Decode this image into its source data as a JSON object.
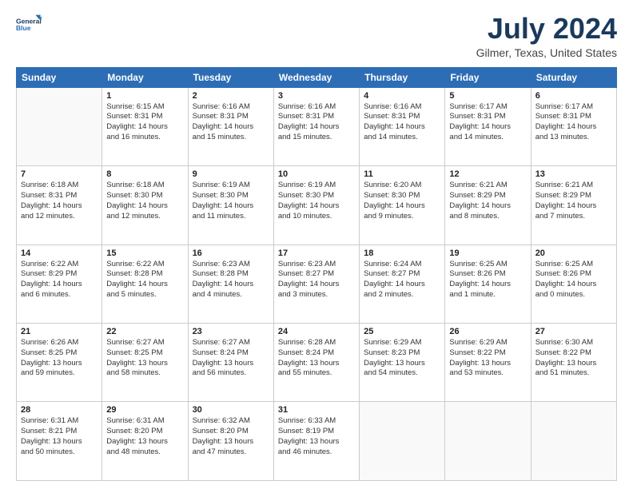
{
  "logo": {
    "line1": "General",
    "line2": "Blue"
  },
  "header": {
    "month": "July 2024",
    "location": "Gilmer, Texas, United States"
  },
  "weekdays": [
    "Sunday",
    "Monday",
    "Tuesday",
    "Wednesday",
    "Thursday",
    "Friday",
    "Saturday"
  ],
  "weeks": [
    [
      {
        "day": "",
        "info": ""
      },
      {
        "day": "1",
        "info": "Sunrise: 6:15 AM\nSunset: 8:31 PM\nDaylight: 14 hours\nand 16 minutes."
      },
      {
        "day": "2",
        "info": "Sunrise: 6:16 AM\nSunset: 8:31 PM\nDaylight: 14 hours\nand 15 minutes."
      },
      {
        "day": "3",
        "info": "Sunrise: 6:16 AM\nSunset: 8:31 PM\nDaylight: 14 hours\nand 15 minutes."
      },
      {
        "day": "4",
        "info": "Sunrise: 6:16 AM\nSunset: 8:31 PM\nDaylight: 14 hours\nand 14 minutes."
      },
      {
        "day": "5",
        "info": "Sunrise: 6:17 AM\nSunset: 8:31 PM\nDaylight: 14 hours\nand 14 minutes."
      },
      {
        "day": "6",
        "info": "Sunrise: 6:17 AM\nSunset: 8:31 PM\nDaylight: 14 hours\nand 13 minutes."
      }
    ],
    [
      {
        "day": "7",
        "info": "Sunrise: 6:18 AM\nSunset: 8:31 PM\nDaylight: 14 hours\nand 12 minutes."
      },
      {
        "day": "8",
        "info": "Sunrise: 6:18 AM\nSunset: 8:30 PM\nDaylight: 14 hours\nand 12 minutes."
      },
      {
        "day": "9",
        "info": "Sunrise: 6:19 AM\nSunset: 8:30 PM\nDaylight: 14 hours\nand 11 minutes."
      },
      {
        "day": "10",
        "info": "Sunrise: 6:19 AM\nSunset: 8:30 PM\nDaylight: 14 hours\nand 10 minutes."
      },
      {
        "day": "11",
        "info": "Sunrise: 6:20 AM\nSunset: 8:30 PM\nDaylight: 14 hours\nand 9 minutes."
      },
      {
        "day": "12",
        "info": "Sunrise: 6:21 AM\nSunset: 8:29 PM\nDaylight: 14 hours\nand 8 minutes."
      },
      {
        "day": "13",
        "info": "Sunrise: 6:21 AM\nSunset: 8:29 PM\nDaylight: 14 hours\nand 7 minutes."
      }
    ],
    [
      {
        "day": "14",
        "info": "Sunrise: 6:22 AM\nSunset: 8:29 PM\nDaylight: 14 hours\nand 6 minutes."
      },
      {
        "day": "15",
        "info": "Sunrise: 6:22 AM\nSunset: 8:28 PM\nDaylight: 14 hours\nand 5 minutes."
      },
      {
        "day": "16",
        "info": "Sunrise: 6:23 AM\nSunset: 8:28 PM\nDaylight: 14 hours\nand 4 minutes."
      },
      {
        "day": "17",
        "info": "Sunrise: 6:23 AM\nSunset: 8:27 PM\nDaylight: 14 hours\nand 3 minutes."
      },
      {
        "day": "18",
        "info": "Sunrise: 6:24 AM\nSunset: 8:27 PM\nDaylight: 14 hours\nand 2 minutes."
      },
      {
        "day": "19",
        "info": "Sunrise: 6:25 AM\nSunset: 8:26 PM\nDaylight: 14 hours\nand 1 minute."
      },
      {
        "day": "20",
        "info": "Sunrise: 6:25 AM\nSunset: 8:26 PM\nDaylight: 14 hours\nand 0 minutes."
      }
    ],
    [
      {
        "day": "21",
        "info": "Sunrise: 6:26 AM\nSunset: 8:25 PM\nDaylight: 13 hours\nand 59 minutes."
      },
      {
        "day": "22",
        "info": "Sunrise: 6:27 AM\nSunset: 8:25 PM\nDaylight: 13 hours\nand 58 minutes."
      },
      {
        "day": "23",
        "info": "Sunrise: 6:27 AM\nSunset: 8:24 PM\nDaylight: 13 hours\nand 56 minutes."
      },
      {
        "day": "24",
        "info": "Sunrise: 6:28 AM\nSunset: 8:24 PM\nDaylight: 13 hours\nand 55 minutes."
      },
      {
        "day": "25",
        "info": "Sunrise: 6:29 AM\nSunset: 8:23 PM\nDaylight: 13 hours\nand 54 minutes."
      },
      {
        "day": "26",
        "info": "Sunrise: 6:29 AM\nSunset: 8:22 PM\nDaylight: 13 hours\nand 53 minutes."
      },
      {
        "day": "27",
        "info": "Sunrise: 6:30 AM\nSunset: 8:22 PM\nDaylight: 13 hours\nand 51 minutes."
      }
    ],
    [
      {
        "day": "28",
        "info": "Sunrise: 6:31 AM\nSunset: 8:21 PM\nDaylight: 13 hours\nand 50 minutes."
      },
      {
        "day": "29",
        "info": "Sunrise: 6:31 AM\nSunset: 8:20 PM\nDaylight: 13 hours\nand 48 minutes."
      },
      {
        "day": "30",
        "info": "Sunrise: 6:32 AM\nSunset: 8:20 PM\nDaylight: 13 hours\nand 47 minutes."
      },
      {
        "day": "31",
        "info": "Sunrise: 6:33 AM\nSunset: 8:19 PM\nDaylight: 13 hours\nand 46 minutes."
      },
      {
        "day": "",
        "info": ""
      },
      {
        "day": "",
        "info": ""
      },
      {
        "day": "",
        "info": ""
      }
    ]
  ]
}
